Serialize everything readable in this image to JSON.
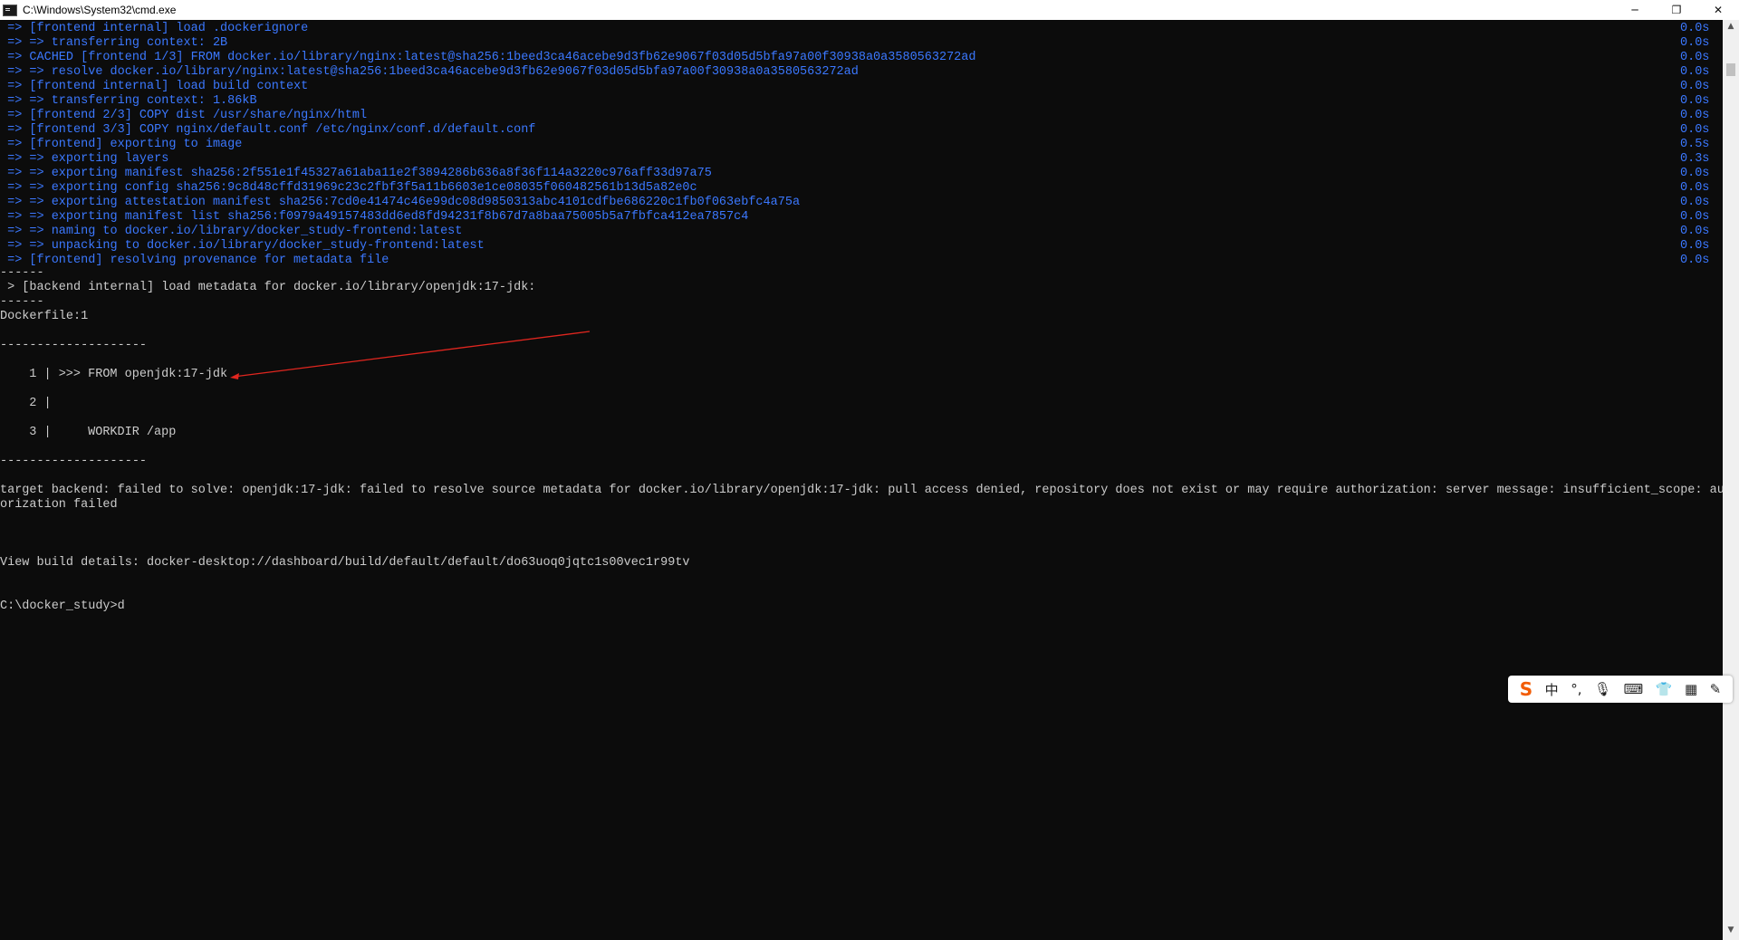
{
  "window": {
    "title": "C:\\Windows\\System32\\cmd.exe",
    "minimize": "─",
    "maximize": "❐",
    "close": "✕"
  },
  "log_lines": [
    {
      "text": " => [frontend internal] load .dockerignore",
      "time": "0.0s"
    },
    {
      "text": " => => transferring context: 2B",
      "time": "0.0s"
    },
    {
      "text": " => CACHED [frontend 1/3] FROM docker.io/library/nginx:latest@sha256:1beed3ca46acebe9d3fb62e9067f03d05d5bfa97a00f30938a0a3580563272ad",
      "time": "0.0s"
    },
    {
      "text": " => => resolve docker.io/library/nginx:latest@sha256:1beed3ca46acebe9d3fb62e9067f03d05d5bfa97a00f30938a0a3580563272ad",
      "time": "0.0s"
    },
    {
      "text": " => [frontend internal] load build context",
      "time": "0.0s"
    },
    {
      "text": " => => transferring context: 1.86kB",
      "time": "0.0s"
    },
    {
      "text": " => [frontend 2/3] COPY dist /usr/share/nginx/html",
      "time": "0.0s"
    },
    {
      "text": " => [frontend 3/3] COPY nginx/default.conf /etc/nginx/conf.d/default.conf",
      "time": "0.0s"
    },
    {
      "text": " => [frontend] exporting to image",
      "time": "0.5s"
    },
    {
      "text": " => => exporting layers",
      "time": "0.3s"
    },
    {
      "text": " => => exporting manifest sha256:2f551e1f45327a61aba11e2f3894286b636a8f36f114a3220c976aff33d97a75",
      "time": "0.0s"
    },
    {
      "text": " => => exporting config sha256:9c8d48cffd31969c23c2fbf3f5a11b6603e1ce08035f060482561b13d5a82e0c",
      "time": "0.0s"
    },
    {
      "text": " => => exporting attestation manifest sha256:7cd0e41474c46e99dc08d9850313abc4101cdfbe686220c1fb0f063ebfc4a75a",
      "time": "0.0s"
    },
    {
      "text": " => => exporting manifest list sha256:f0979a49157483dd6ed8fd94231f8b67d7a8baa75005b5a7fbfca412ea7857c4",
      "time": "0.0s"
    },
    {
      "text": " => => naming to docker.io/library/docker_study-frontend:latest",
      "time": "0.0s"
    },
    {
      "text": " => => unpacking to docker.io/library/docker_study-frontend:latest",
      "time": "0.0s"
    },
    {
      "text": " => [frontend] resolving provenance for metadata file",
      "time": "0.0s"
    }
  ],
  "output": {
    "sep_short": "------",
    "backend_meta": " > [backend internal] load metadata for docker.io/library/openjdk:17-jdk:",
    "sep_short_2": "------",
    "dockerfile": "Dockerfile:1",
    "sep_long": "--------------------",
    "code_line_1": "   1 | >>> FROM openjdk:17-jdk",
    "code_line_2": "   2 |",
    "code_line_3": "   3 |     WORKDIR /app",
    "sep_long_2": "--------------------",
    "error_1": "target backend: failed to solve: openjdk:17-jdk: failed to resolve source metadata for docker.io/library/openjdk:17-jdk: pull access denied, repository does not exist or may require authorization: server message: insufficient_scope: auth",
    "error_2": "orization failed",
    "view_details": "View build details: docker-desktop://dashboard/build/default/default/do63uoq0jqtc1s00vec1r99tv",
    "prompt": "C:\\docker_study>d"
  },
  "ime": {
    "logo": "S",
    "lang": "中",
    "punct": "°,",
    "mic": "🎙",
    "keyboard": "⌨",
    "skin": "👕",
    "grid": "▦",
    "more": "✎"
  },
  "colors": {
    "log_blue": "#3b78ff",
    "text_gray": "#cccccc",
    "arrow_red": "#e0261f",
    "background": "#0c0c0c"
  }
}
